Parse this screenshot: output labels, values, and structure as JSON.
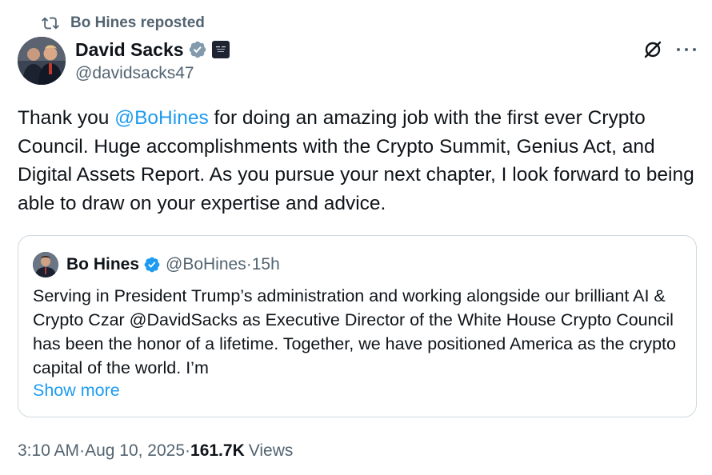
{
  "repost": {
    "text": "Bo Hines reposted",
    "icon": "repost-icon"
  },
  "author": {
    "name": "David Sacks",
    "handle": "@davidsacks47",
    "verified": "grey-verified-icon",
    "affiliation_badge": "affiliation-badge-icon"
  },
  "actions": {
    "grok_icon": "grok-icon",
    "more_icon": "more-icon"
  },
  "tweet": {
    "text_1": "Thank you ",
    "mention": "@BoHines",
    "text_2": " for doing an amazing job with the first ever Crypto Council. Huge accomplishments with the Crypto Summit, Genius Act, and Digital Assets Report. As you pursue your next chapter, I look forward to being able to draw on your expertise and advice."
  },
  "quote": {
    "name": "Bo Hines",
    "handle": "@BoHines",
    "time": "15h",
    "separator": " · ",
    "text": "Serving in President Trump’s administration and working alongside our brilliant AI & Crypto Czar @DavidSacks as Executive Director of the White House Crypto Council has been the honor of a lifetime. Together, we have positioned America as the crypto capital of the world. I’m",
    "show_more": "Show more"
  },
  "footer": {
    "time": "3:10 AM",
    "dot": " · ",
    "date": "Aug 10, 2025",
    "views_count": "161.7K",
    "views_label": "Views"
  },
  "colors": {
    "accent": "#1d9bf0",
    "muted": "#536471",
    "text": "#0f1419",
    "border": "#cfd9de"
  }
}
